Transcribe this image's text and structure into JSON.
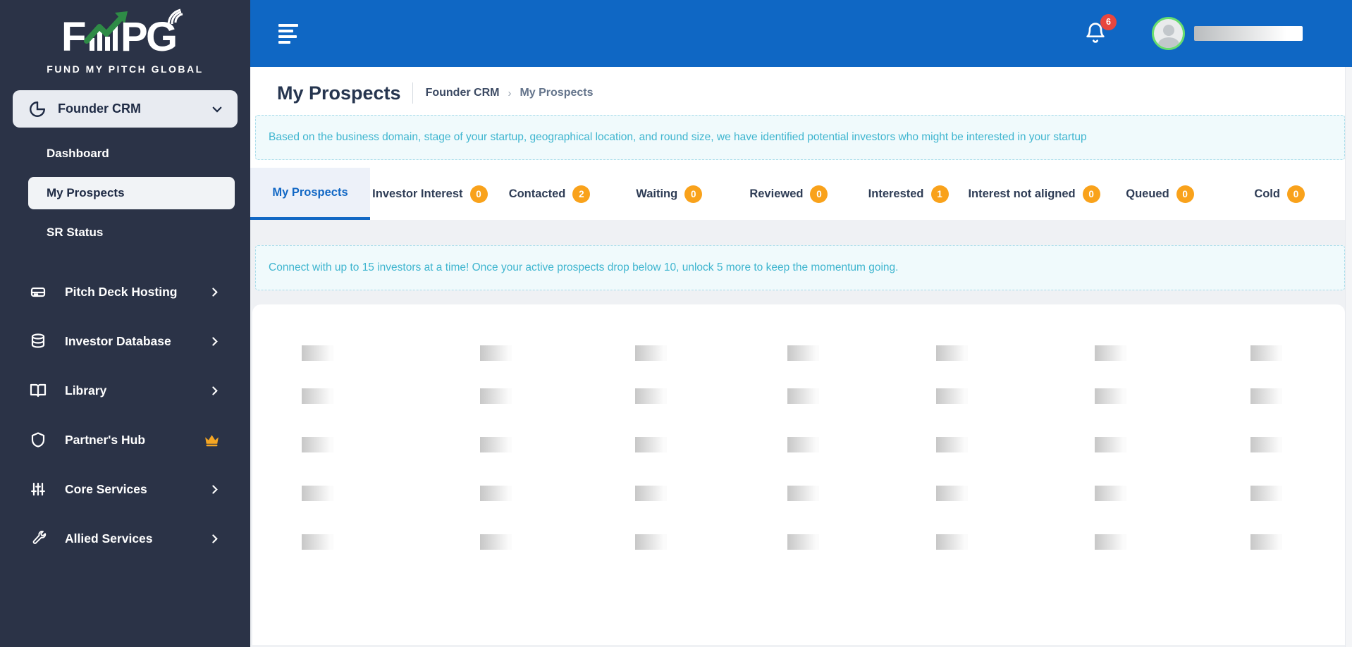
{
  "brand": {
    "logo_text": "FMPG",
    "tagline": "FUND MY PITCH GLOBAL"
  },
  "sidebar": {
    "group": {
      "label": "Founder CRM",
      "icon": "pie-chart-icon",
      "state": "expanded"
    },
    "sub_items": [
      {
        "label": "Dashboard",
        "active": false
      },
      {
        "label": "My Prospects",
        "active": true
      },
      {
        "label": "SR Status",
        "active": false
      }
    ],
    "items": [
      {
        "label": "Pitch Deck Hosting",
        "icon": "hard-drive-icon",
        "trailing": "chevron-right-icon"
      },
      {
        "label": "Investor Database",
        "icon": "database-icon",
        "trailing": "chevron-right-icon"
      },
      {
        "label": "Library",
        "icon": "book-open-icon",
        "trailing": "chevron-right-icon"
      },
      {
        "label": "Partner's Hub",
        "icon": "shield-icon",
        "trailing": "crown-icon"
      },
      {
        "label": "Core Services",
        "icon": "sliders-icon",
        "trailing": "chevron-right-icon"
      },
      {
        "label": "Allied Services",
        "icon": "wrench-icon",
        "trailing": "chevron-right-icon"
      }
    ]
  },
  "header": {
    "notification_count": "6"
  },
  "page": {
    "title": "My Prospects",
    "breadcrumb": {
      "root": "Founder CRM",
      "separator": "›",
      "leaf": "My Prospects"
    }
  },
  "banners": {
    "intro": "Based on the business domain, stage of your startup, geographical location, and round size, we have identified potential investors who might be interested in your startup",
    "limit": "Connect with up to 15 investors at a time! Once your active prospects drop below 10, unlock 5 more to keep the momentum going."
  },
  "tabs": [
    {
      "label": "My Prospects",
      "active": true
    },
    {
      "label": "Investor Interest",
      "badge": "0"
    },
    {
      "label": "Contacted",
      "badge": "2"
    },
    {
      "label": "Waiting",
      "badge": "0"
    },
    {
      "label": "Reviewed",
      "badge": "0"
    },
    {
      "label": "Interested",
      "badge": "1"
    },
    {
      "label": "Interest not aligned",
      "badge": "0"
    },
    {
      "label": "Queued",
      "badge": "0"
    },
    {
      "label": "Cold",
      "badge": "0"
    }
  ],
  "skeleton": {
    "rows": 5,
    "cols": 7
  },
  "colors": {
    "header_blue": "#0f67c4",
    "sidebar_navy": "#2b3347",
    "badge_orange": "#f9a21b",
    "notification_red": "#e8463d",
    "banner_teal": "#3eb5cf",
    "active_tab_blue": "#1268c5",
    "avatar_ring_green": "#67dd6e",
    "logo_arrow_green": "#2e8b46"
  }
}
